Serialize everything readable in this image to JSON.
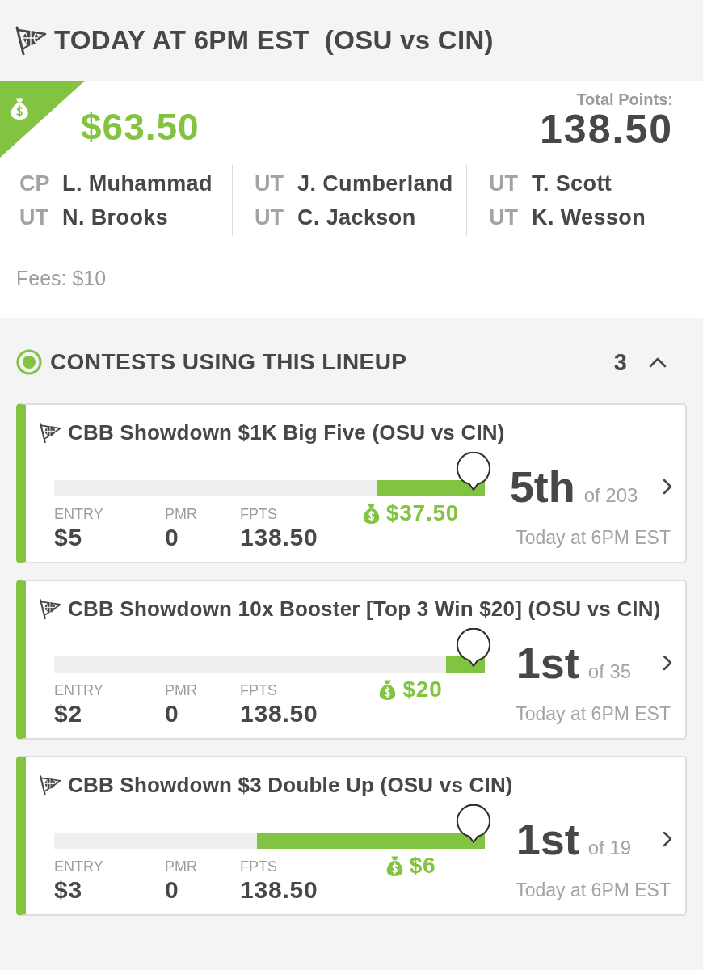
{
  "header": {
    "title": "TODAY AT 6PM EST  (OSU vs CIN)"
  },
  "summary": {
    "winnings": "$63.50",
    "total_points_label": "Total Points:",
    "total_points": "138.50",
    "lineup_columns": [
      {
        "players": [
          {
            "position": "CP",
            "name": "L. Muhammad"
          },
          {
            "position": "UT",
            "name": "N. Brooks"
          }
        ]
      },
      {
        "players": [
          {
            "position": "UT",
            "name": "J. Cumberland"
          },
          {
            "position": "UT",
            "name": "C. Jackson"
          }
        ]
      },
      {
        "players": [
          {
            "position": "UT",
            "name": "T. Scott"
          },
          {
            "position": "UT",
            "name": "K. Wesson"
          }
        ]
      }
    ],
    "fees": "Fees: $10"
  },
  "contests": {
    "title": "CONTESTS USING THIS LINEUP",
    "count": "3",
    "expanded": true,
    "items": [
      {
        "title": "CBB Showdown $1K Big Five (OSU vs CIN)",
        "level": 0.25,
        "prize": "$37.50",
        "stats": [
          {
            "label": "ENTRY",
            "value": "$5"
          },
          {
            "label": "PMR",
            "value": "0"
          },
          {
            "label": "FPTS",
            "value": "138.50"
          }
        ],
        "rank": "5th",
        "rank_total": "of 203",
        "time": "Today at 6PM EST"
      },
      {
        "title": "CBB Showdown 10x Booster [Top 3 Win $20] (OSU vs CIN)",
        "level": 0.09,
        "prize": "$20",
        "stats": [
          {
            "label": "ENTRY",
            "value": "$2"
          },
          {
            "label": "PMR",
            "value": "0"
          },
          {
            "label": "FPTS",
            "value": "138.50"
          }
        ],
        "rank": "1st",
        "rank_total": "of 35",
        "time": "Today at 6PM EST"
      },
      {
        "title": "CBB Showdown $3 Double Up (OSU vs CIN)",
        "level": 0.53,
        "prize": "$6",
        "stats": [
          {
            "label": "ENTRY",
            "value": "$3"
          },
          {
            "label": "PMR",
            "value": "0"
          },
          {
            "label": "FPTS",
            "value": "138.50"
          }
        ],
        "rank": "1st",
        "rank_total": "of 19",
        "time": "Today at 6PM EST"
      }
    ]
  }
}
